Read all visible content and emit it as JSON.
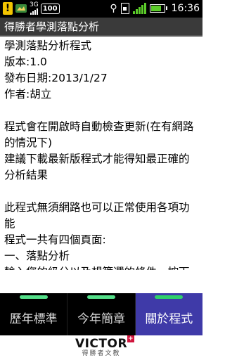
{
  "status_bar": {
    "notification_alert": "!",
    "network_type": "3G",
    "battery_percent_label": "100",
    "time": "16:36",
    "wifi_color": "#5ccc2a",
    "battery_color": "#5ccc2a"
  },
  "title_bar": {
    "title": "得勝者學測落點分析"
  },
  "content": {
    "app_name": "學測落點分析程式",
    "version": "版本:1.0",
    "release_date": "發布日期:2013/1/27",
    "author": "作者:胡立",
    "update_note": "程式會在開啟時自動檢查更新(在有網路的情況下)",
    "recommend_note": "建議下載最新版程式才能得知最正確的分析結果",
    "offline_note": "此程式無須網路也可以正常使用各項功能",
    "pages_note": "程式一共有四個頁面:",
    "section_1_title": "一、落點分析",
    "section_1_body": "輸入您的級分以及想篩選的條件，按下開始分析以後會出現結果落點分析時需要一點時間，請耐心等候"
  },
  "tabs": [
    {
      "label": "歷年標準",
      "active": false
    },
    {
      "label": "今年簡章",
      "active": false
    },
    {
      "label": "關於程式",
      "active": true
    }
  ],
  "colors": {
    "active_tab": "#3f3aa8",
    "tab_indicator": "#2fd16a",
    "logo_accent": "#d0143c"
  },
  "footer": {
    "logo_text": "VICTOR",
    "logo_plus": "+",
    "logo_subtitle": "得勝者文教"
  }
}
